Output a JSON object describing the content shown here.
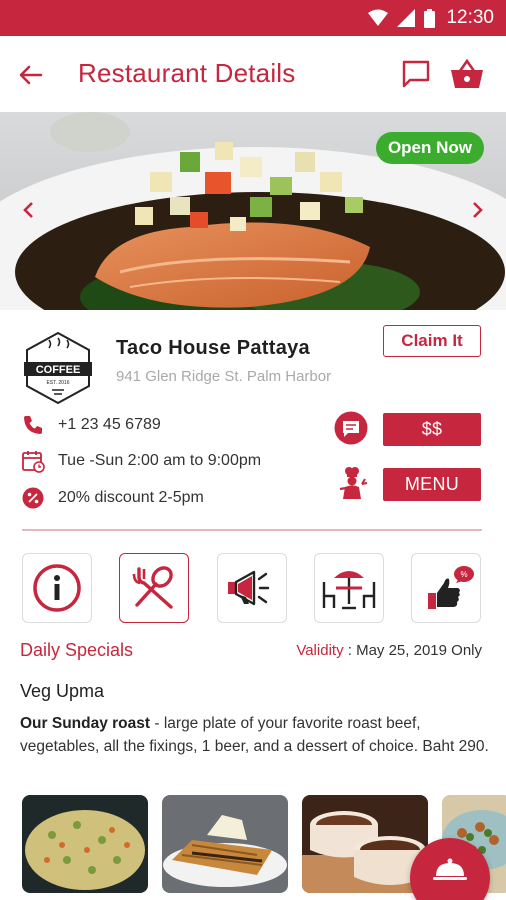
{
  "status_bar": {
    "time": "12:30"
  },
  "app_bar": {
    "title": "Restaurant Details"
  },
  "hero": {
    "badge": "Open Now"
  },
  "restaurant": {
    "logo_text": "COFFEE",
    "logo_subtext": "EST. 2016",
    "name": "Taco House Pattaya",
    "address": "941 Glen Ridge St. Palm Harbor",
    "claim_label": "Claim It",
    "phone": "+1 23 45 6789",
    "hours": "Tue -Sun 2:00 am to 9:00pm",
    "discount": "20% discount 2-5pm",
    "price_label": "$$",
    "menu_label": "MENU"
  },
  "categories": [
    {
      "icon": "info-icon",
      "active": false
    },
    {
      "icon": "fork-spoon-icon",
      "active": true
    },
    {
      "icon": "megaphone-icon",
      "active": false
    },
    {
      "icon": "table-umbrella-icon",
      "active": false
    },
    {
      "icon": "thumbs-up-offer-icon",
      "active": false
    }
  ],
  "daily_specials": {
    "title": "Daily Specials",
    "validity_label": "Validity",
    "validity_value": ": May 25, 2019 Only",
    "dish_name": "Veg Upma",
    "dish_desc_lead": "Our Sunday roast",
    "dish_desc_rest": " - large plate of your favorite roast beef, vegetables, all the fixings, 1 beer, and a dessert of choice. Baht 290."
  },
  "colors": {
    "primary": "#c6263e",
    "open_badge": "#3cac2e"
  }
}
